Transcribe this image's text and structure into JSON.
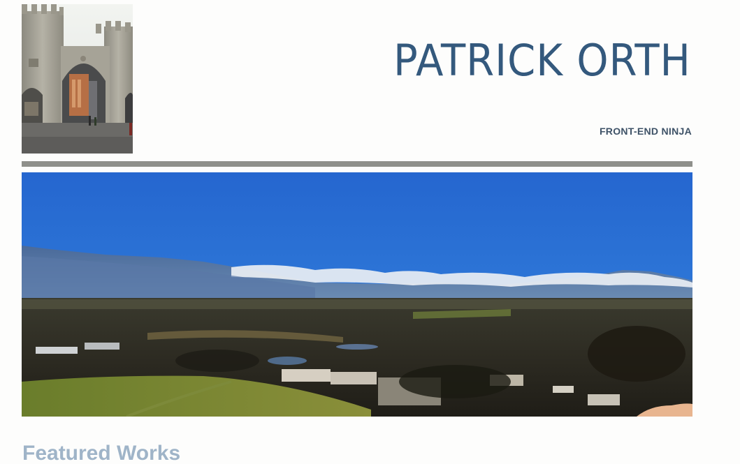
{
  "header": {
    "title": "PATRICK ORTH",
    "subtitle": "FRONT-END NINJA"
  },
  "main": {
    "featured_heading": "Featured Works"
  },
  "colors": {
    "title": "#34597d",
    "subtitle": "#3e5267",
    "divider": "#8f908b",
    "heading": "#9fb4c8",
    "sky": "#2d71d6"
  }
}
